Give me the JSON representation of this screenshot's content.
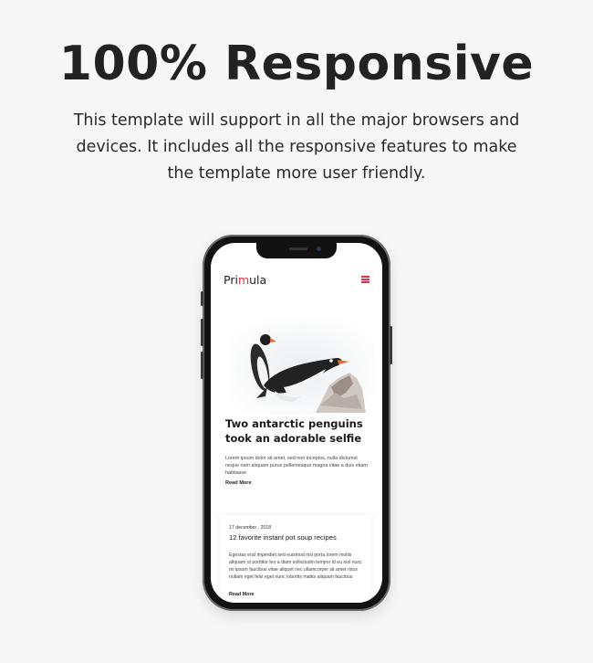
{
  "heading": "100% Responsive",
  "description": "This template will support in all the major browsers and devices. It includes all the responsive features to make the template more user friendly.",
  "phone": {
    "logo_pre": "Pri",
    "logo_accent": "m",
    "logo_post": "ula",
    "accent_color": "#e0334a",
    "menu_icon": "hamburger-icon",
    "featured_post": {
      "image": "penguins-photo",
      "title": "Two antarctic penguins took an adorable selfie",
      "excerpt": "Lorem ipsum dolor sit amet, sed non inceptos, nulla dictumst neque nam aliquam purus pellentesque magna vitae a duis etiam habitasse",
      "read_more": "Read More"
    },
    "card_post": {
      "date": "17 december , 2018",
      "title": "12 favorite instant pot soup recipes",
      "excerpt": "Egestas erat imperdiet sed euismod nisi porta lorem mollis aliquam ut porttitor leo a diam sollicitudin tempor id eu nisl nunc mi ipsum faucibus vitae aliquet nec ullamcorper sit amet risus nullam eget felis eget nunc lobortis mattis aliquam faucibus",
      "read_more": "Read More"
    }
  }
}
